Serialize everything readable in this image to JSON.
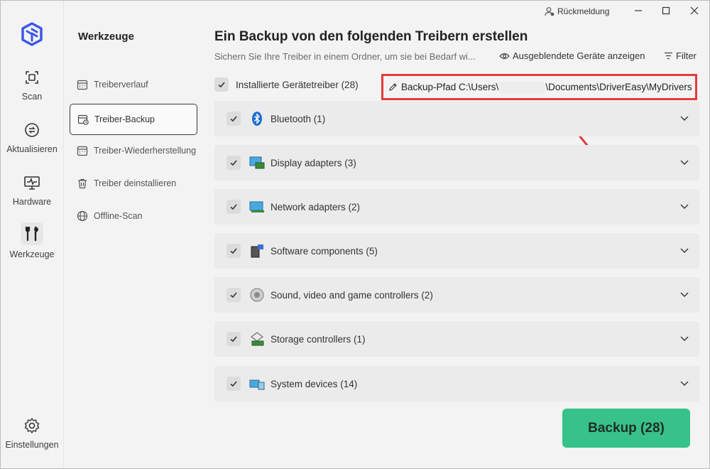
{
  "titlebar": {
    "feedback_label": "Rückmeldung"
  },
  "rail": {
    "items": [
      {
        "label": "Scan",
        "icon": "scan-icon"
      },
      {
        "label": "Aktualisieren",
        "icon": "refresh-icon"
      },
      {
        "label": "Hardware",
        "icon": "hardware-icon"
      },
      {
        "label": "Werkzeuge",
        "icon": "tools-icon"
      }
    ],
    "settings_label": "Einstellungen"
  },
  "tools": {
    "title": "Werkzeuge",
    "items": [
      {
        "label": "Treiberverlauf",
        "icon": "calendar-icon"
      },
      {
        "label": "Treiber-Backup",
        "icon": "backup-icon"
      },
      {
        "label": "Treiber-Wiederherstellung",
        "icon": "restore-icon"
      },
      {
        "label": "Treiber deinstallieren",
        "icon": "trash-icon"
      },
      {
        "label": "Offline-Scan",
        "icon": "globe-icon"
      }
    ]
  },
  "main": {
    "heading": "Ein Backup von den folgenden Treibern erstellen",
    "subtitle": "Sichern Sie Ihre Treiber in einem Ordner, um sie bei Bedarf wi...",
    "show_hidden_label": "Ausgeblendete Geräte anzeigen",
    "filter_label": "Filter",
    "master_label": "Installierte Gerätetreiber (28)",
    "path_prefix": "Backup-Pfad C:\\Users\\",
    "path_suffix": "\\Documents\\DriverEasy\\MyDrivers",
    "categories": [
      {
        "label": "Bluetooth (1)",
        "icon": "bluetooth-icon"
      },
      {
        "label": "Display adapters (3)",
        "icon": "display-adapter-icon"
      },
      {
        "label": "Network adapters (2)",
        "icon": "network-adapter-icon"
      },
      {
        "label": "Software components (5)",
        "icon": "software-component-icon"
      },
      {
        "label": "Sound, video and game controllers (2)",
        "icon": "speaker-icon"
      },
      {
        "label": "Storage controllers (1)",
        "icon": "storage-controller-icon"
      },
      {
        "label": "System devices (14)",
        "icon": "system-device-icon"
      }
    ],
    "backup_button_label": "Backup (28)"
  },
  "colors": {
    "accent_green": "#37c28a",
    "highlight_red": "#e63a3a",
    "logo_blue": "#3a57e8"
  }
}
